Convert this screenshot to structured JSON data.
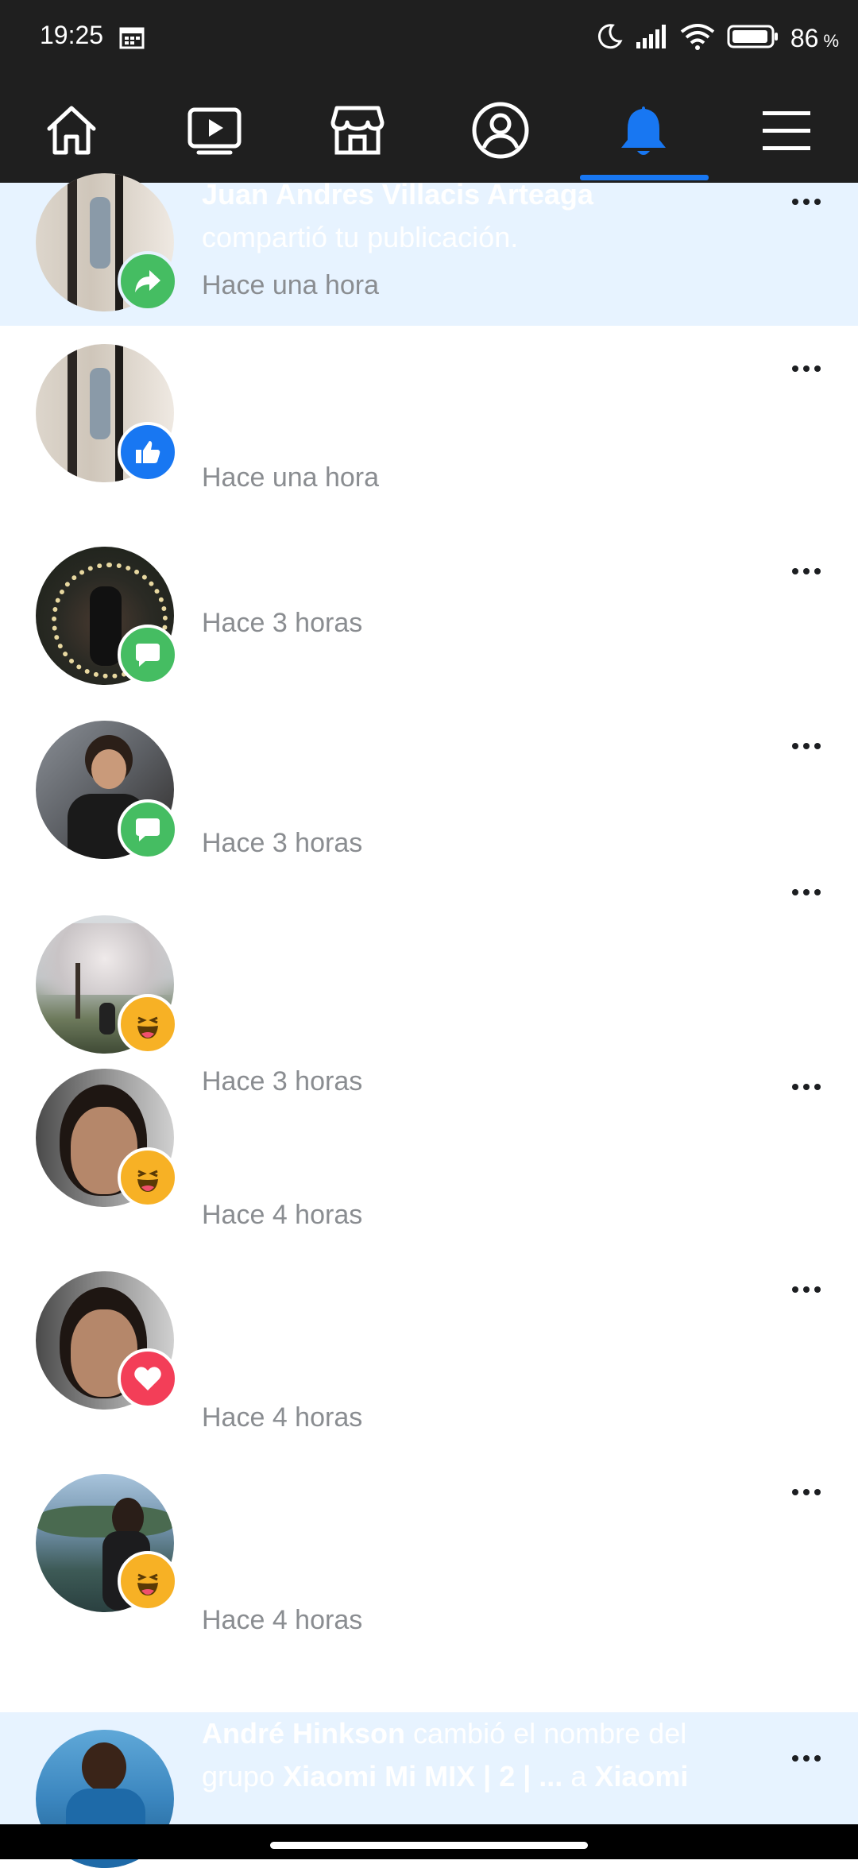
{
  "status_bar": {
    "time": "19:25",
    "battery_percent": "86",
    "percent_sign": "%"
  },
  "nav": {
    "items": [
      {
        "name": "home",
        "icon": "home-icon"
      },
      {
        "name": "watch",
        "icon": "video-icon"
      },
      {
        "name": "marketplace",
        "icon": "store-icon"
      },
      {
        "name": "profile",
        "icon": "profile-icon"
      },
      {
        "name": "notifications",
        "icon": "bell-icon",
        "active": true
      },
      {
        "name": "menu",
        "icon": "hamburger-icon"
      }
    ],
    "active_color": "#1877f2"
  },
  "notifications": [
    {
      "name": "Juan Andres Villacis Arteaga",
      "text": "compartió tu publicación.",
      "time": "Hace una hora",
      "badge": "share",
      "unread": true
    },
    {
      "time": "Hace una hora",
      "badge": "like",
      "unread": false
    },
    {
      "time": "Hace 3 horas",
      "badge": "comment",
      "unread": false
    },
    {
      "time": "Hace 3 horas",
      "badge": "comment",
      "unread": false
    },
    {
      "time": "Hace 3 horas",
      "badge": "haha",
      "unread": false
    },
    {
      "time": "Hace 4 horas",
      "badge": "haha",
      "unread": false
    },
    {
      "time": "Hace 4 horas",
      "badge": "love",
      "unread": false
    },
    {
      "time": "Hace 4 horas",
      "badge": "haha",
      "unread": false
    },
    {
      "name": "André Hinkson",
      "text_a": "cambió el nombre del",
      "text_b": "grupo",
      "group": "Xiaomi Mi MIX | 2 | ...",
      "text_c": "a",
      "new_name": "Xiaomi",
      "unread": true
    }
  ],
  "colors": {
    "unread_bg": "#e7f3ff",
    "time_text": "#8a8d91",
    "share_badge": "#45bd62",
    "like_badge": "#1877f2",
    "comment_badge": "#45bd62",
    "love_badge": "#f33e58",
    "haha_badge": "#f7b125"
  }
}
